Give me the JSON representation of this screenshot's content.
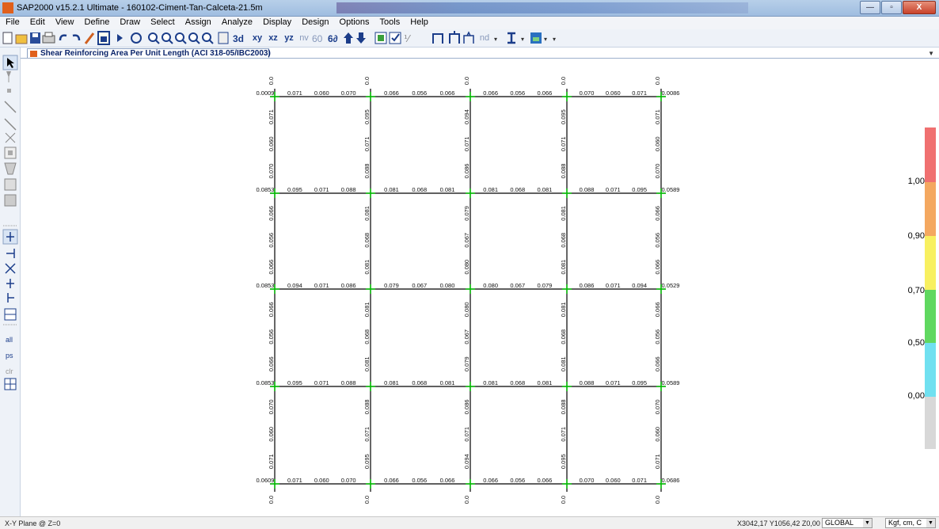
{
  "app": {
    "title": "SAP2000 v15.2.1 Ultimate  - 160102-Ciment-Tan-Calceta-21.5m",
    "icon_label": "X"
  },
  "window_buttons": [
    "—",
    "▫",
    "X"
  ],
  "menu": [
    "File",
    "Edit",
    "View",
    "Define",
    "Draw",
    "Select",
    "Assign",
    "Analyze",
    "Display",
    "Design",
    "Options",
    "Tools",
    "Help"
  ],
  "toolbar": {
    "items": [
      "new-file-icon",
      "open-icon",
      "save-icon",
      "print-icon",
      "undo-icon",
      "redo-icon",
      "lock-icon",
      "refresh-window-icon",
      "run-icon",
      "rubber-band-zoom-icon",
      "restore-view-icon",
      "zoom-in-icon",
      "zoom-out-icon",
      "pan-icon",
      "3d-view-icon",
      "xy-view",
      "xz-view",
      "yz-view",
      "nv-view",
      "perspective-icon",
      "rotate-3d-icon",
      "up-arrow-icon",
      "down-arrow-icon",
      "object-shrink-icon",
      "set-display-options-icon",
      "show-undeformed-icon",
      "show-deformed-icon",
      "show-forces-icon",
      "show-design-icon"
    ],
    "labels": {
      "xy": "xy",
      "xz": "xz",
      "yz": "yz",
      "nv": "nv",
      "nd": "nd"
    }
  },
  "document_tab": {
    "title": "Shear Reinforcing Area Per Unit Length  (ACI 318-05/IBC2003)"
  },
  "model": {
    "horizontal_rows": [
      {
        "left_overlap": "0.0●0●0●9",
        "spans": [
          [
            "0.071",
            "0.060",
            "0.070"
          ],
          [
            "0.066",
            "0.056",
            "0.066"
          ],
          [
            "0.066",
            "0.056",
            "0.066"
          ],
          [
            "0.070",
            "0.060",
            "0.071"
          ]
        ],
        "right_overlap": "0.0●0●8●6"
      },
      {
        "left_overlap": "0.0●8●5●3",
        "spans": [
          [
            "0.095",
            "0.071",
            "0.088"
          ],
          [
            "0.081",
            "0.068",
            "0.081"
          ],
          [
            "0.081",
            "0.068",
            "0.081"
          ],
          [
            "0.088",
            "0.071",
            "0.095"
          ]
        ],
        "right_overlap": "0.0●5●8●9"
      },
      {
        "left_overlap": "0.0●8●5●3",
        "spans": [
          [
            "0.094",
            "0.071",
            "0.086"
          ],
          [
            "0.079",
            "0.067",
            "0.080"
          ],
          [
            "0.080",
            "0.067",
            "0.079"
          ],
          [
            "0.086",
            "0.071",
            "0.094"
          ]
        ],
        "right_overlap": "0.0●5●2●9"
      },
      {
        "left_overlap": "0.0●8●5●3",
        "spans": [
          [
            "0.095",
            "0.071",
            "0.088"
          ],
          [
            "0.081",
            "0.068",
            "0.081"
          ],
          [
            "0.081",
            "0.068",
            "0.081"
          ],
          [
            "0.088",
            "0.071",
            "0.095"
          ]
        ],
        "right_overlap": "0.0●5●8●9"
      },
      {
        "left_overlap": "0.0●6●0●9",
        "spans": [
          [
            "0.071",
            "0.060",
            "0.070"
          ],
          [
            "0.066",
            "0.056",
            "0.066"
          ],
          [
            "0.066",
            "0.056",
            "0.066"
          ],
          [
            "0.070",
            "0.060",
            "0.071"
          ]
        ],
        "right_overlap": "0.0●6●8●6"
      }
    ],
    "vertical_cols": [
      {
        "spans": [
          [
            "0.071",
            "0.060",
            "0.070"
          ],
          [
            "0.066",
            "0.056",
            "0.066"
          ],
          [
            "0.066",
            "0.056",
            "0.066"
          ],
          [
            "0.070",
            "0.060",
            "0.071"
          ]
        ]
      },
      {
        "spans": [
          [
            "0.095",
            "0.071",
            "0.088"
          ],
          [
            "0.081",
            "0.068",
            "0.081"
          ],
          [
            "0.081",
            "0.068",
            "0.081"
          ],
          [
            "0.088",
            "0.071",
            "0.095"
          ]
        ]
      },
      {
        "spans": [
          [
            "0.094",
            "0.071",
            "0.086"
          ],
          [
            "0.079",
            "0.067",
            "0.080"
          ],
          [
            "0.080",
            "0.067",
            "0.079"
          ],
          [
            "0.086",
            "0.071",
            "0.094"
          ]
        ]
      },
      {
        "spans": [
          [
            "0.095",
            "0.071",
            "0.088"
          ],
          [
            "0.081",
            "0.068",
            "0.081"
          ],
          [
            "0.081",
            "0.068",
            "0.081"
          ],
          [
            "0.088",
            "0.071",
            "0.095"
          ]
        ]
      },
      {
        "spans": [
          [
            "0.071",
            "0.060",
            "0.070"
          ],
          [
            "0.066",
            "0.056",
            "0.066"
          ],
          [
            "0.066",
            "0.056",
            "0.066"
          ],
          [
            "0.070",
            "0.060",
            "0.071"
          ]
        ]
      }
    ],
    "colors": {
      "member": "#000000",
      "joint": "#00c000"
    }
  },
  "legend": {
    "labels": [
      "1,00",
      "0,90",
      "0,70",
      "0,50",
      "0,00"
    ],
    "colors": [
      "#f07070",
      "#f4a860",
      "#f8f060",
      "#60d860",
      "#70e0f0",
      "#d8d8d8"
    ]
  },
  "status": {
    "plane": "X-Y Plane @ Z=0",
    "coords": "X3042,17  Y1056,42  Z0,00",
    "coord_system": "GLOBAL",
    "units": "Kgf, cm, C"
  }
}
